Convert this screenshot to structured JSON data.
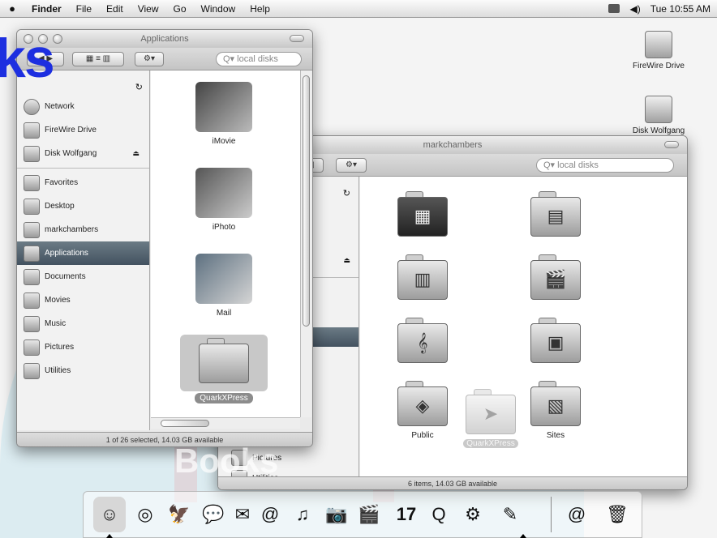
{
  "menubar": {
    "apple": "",
    "items": [
      "Finder",
      "File",
      "Edit",
      "View",
      "Go",
      "Window",
      "Help"
    ],
    "clock": "Tue 10:55 AM"
  },
  "desktop": {
    "icons": [
      "FireWire Drive",
      "Disk Wolfgang"
    ]
  },
  "watermark": {
    "brand": "ks",
    "books": "Books"
  },
  "front_window": {
    "title": "Applications",
    "search_placeholder": "local disks",
    "status": "1 of 26 selected, 14.03 GB available",
    "sidebar": [
      {
        "label": "Network",
        "icon": "network-icon"
      },
      {
        "label": "FireWire Drive",
        "icon": "drive-icon"
      },
      {
        "label": "Disk Wolfgang",
        "icon": "disk-icon",
        "eject": "⏏"
      },
      {
        "label": "Favorites",
        "icon": "folder-icon"
      },
      {
        "label": "Desktop",
        "icon": "desktop-icon"
      },
      {
        "label": "markchambers",
        "icon": "home-icon"
      },
      {
        "label": "Applications",
        "icon": "applications-icon",
        "selected": true
      },
      {
        "label": "Documents",
        "icon": "documents-icon"
      },
      {
        "label": "Movies",
        "icon": "movies-icon"
      },
      {
        "label": "Music",
        "icon": "music-icon"
      },
      {
        "label": "Pictures",
        "icon": "pictures-icon"
      },
      {
        "label": "Utilities",
        "icon": "utilities-icon"
      }
    ],
    "apps": [
      "iMovie",
      "iPhoto",
      "Mail",
      "QuarkXPress"
    ]
  },
  "back_window": {
    "title": "markchambers",
    "search_placeholder": "local disks",
    "status": "6 items, 14.03 GB available",
    "sidebar_tail": [
      "Pictures",
      "Utilities"
    ],
    "folders": [
      {
        "label": "",
        "glyph": "▦"
      },
      {
        "label": "",
        "glyph": "▤"
      },
      {
        "label": "",
        "glyph": "▥"
      },
      {
        "label": "",
        "glyph": "🎬"
      },
      {
        "label": "",
        "glyph": "𝄞"
      },
      {
        "label": "",
        "glyph": "▣"
      },
      {
        "label": "Public",
        "glyph": "◈"
      },
      {
        "label": "Sites",
        "glyph": "▧"
      }
    ],
    "dragging": "QuarkXPress"
  },
  "dock": {
    "items": [
      "finder-icon",
      "safari-icon",
      "preview-icon",
      "ichat-icon",
      "address-book-icon",
      "mail-icon",
      "itunes-icon",
      "iphoto-icon",
      "imovie-icon",
      "ical-icon",
      "quicktime-icon",
      "system-preferences-icon",
      "quarkxpress-icon",
      "internet-connect-icon",
      "trash-icon"
    ],
    "glyphs": [
      "☺",
      "◎",
      "🦅",
      "💬",
      "✉",
      "@",
      "♫",
      "📷",
      "🎬",
      "17",
      "Q",
      "⚙",
      "✎",
      "@",
      "🗑"
    ],
    "ical_date": "17"
  }
}
